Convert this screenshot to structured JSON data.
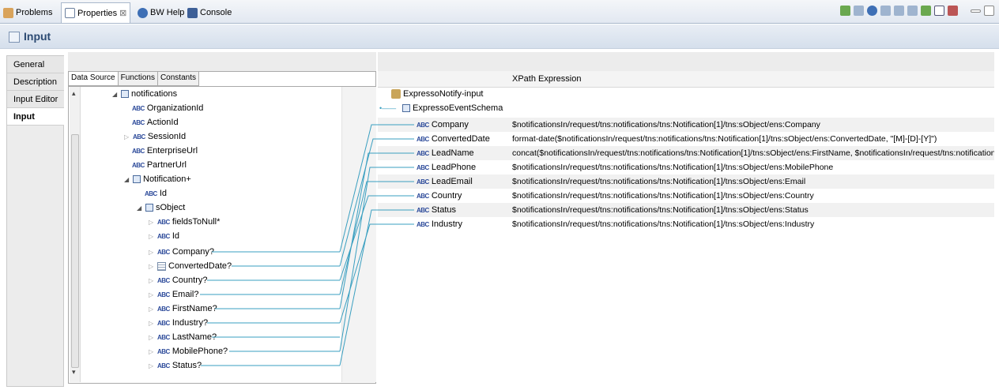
{
  "tabs": [
    {
      "label": "Problems"
    },
    {
      "label": "Properties",
      "close": "⊠"
    },
    {
      "label": "BW Help"
    },
    {
      "label": "Console"
    }
  ],
  "header": {
    "title": "Input"
  },
  "side_tabs": [
    "General",
    "Description",
    "Input Editor",
    "Input"
  ],
  "sub_tabs": [
    "Data Source",
    "Functions",
    "Constants"
  ],
  "tree": [
    {
      "label": "notifications"
    },
    {
      "label": "OrganizationId"
    },
    {
      "label": "ActionId"
    },
    {
      "label": "SessionId"
    },
    {
      "label": "EnterpriseUrl"
    },
    {
      "label": "PartnerUrl"
    },
    {
      "label": "Notification+"
    },
    {
      "label": "Id"
    },
    {
      "label": "sObject"
    },
    {
      "label": "fieldsToNull*"
    },
    {
      "label": "Id"
    },
    {
      "label": "Company?"
    },
    {
      "label": "ConvertedDate?"
    },
    {
      "label": "Country?"
    },
    {
      "label": "Email?"
    },
    {
      "label": "FirstName?"
    },
    {
      "label": "Industry?"
    },
    {
      "label": "LastName?"
    },
    {
      "label": "MobilePhone?"
    },
    {
      "label": "Status?"
    }
  ],
  "right": {
    "column_header": "XPath Expression",
    "root": "ExpressoNotify-input",
    "schema": "ExpressoEventSchema",
    "fields": [
      {
        "name": "Company",
        "xpath": "$notificationsIn/request/tns:notifications/tns:Notification[1]/tns:sObject/ens:Company"
      },
      {
        "name": "ConvertedDate",
        "xpath": "format-date($notificationsIn/request/tns:notifications/tns:Notification[1]/tns:sObject/ens:ConvertedDate, \"[M]-[D]-[Y]\")"
      },
      {
        "name": "LeadName",
        "xpath": "concat($notificationsIn/request/tns:notifications/tns:Notification[1]/tns:sObject/ens:FirstName, $notificationsIn/request/tns:notification..."
      },
      {
        "name": "LeadPhone",
        "xpath": "$notificationsIn/request/tns:notifications/tns:Notification[1]/tns:sObject/ens:MobilePhone"
      },
      {
        "name": "LeadEmail",
        "xpath": "$notificationsIn/request/tns:notifications/tns:Notification[1]/tns:sObject/ens:Email"
      },
      {
        "name": "Country",
        "xpath": "$notificationsIn/request/tns:notifications/tns:Notification[1]/tns:sObject/ens:Country"
      },
      {
        "name": "Status",
        "xpath": "$notificationsIn/request/tns:notifications/tns:Notification[1]/tns:sObject/ens:Status"
      },
      {
        "name": "Industry",
        "xpath": "$notificationsIn/request/tns:notifications/tns:Notification[1]/tns:sObject/ens:Industry"
      }
    ]
  },
  "icons": {
    "abc": "ABC",
    "tree_expanded": "◢",
    "tree_collapsed": "▷",
    "scroll_up": "▴",
    "scroll_down": "▾"
  },
  "colors": {
    "link_line": "#3a9fc0",
    "header_title": "#2c4a72"
  }
}
